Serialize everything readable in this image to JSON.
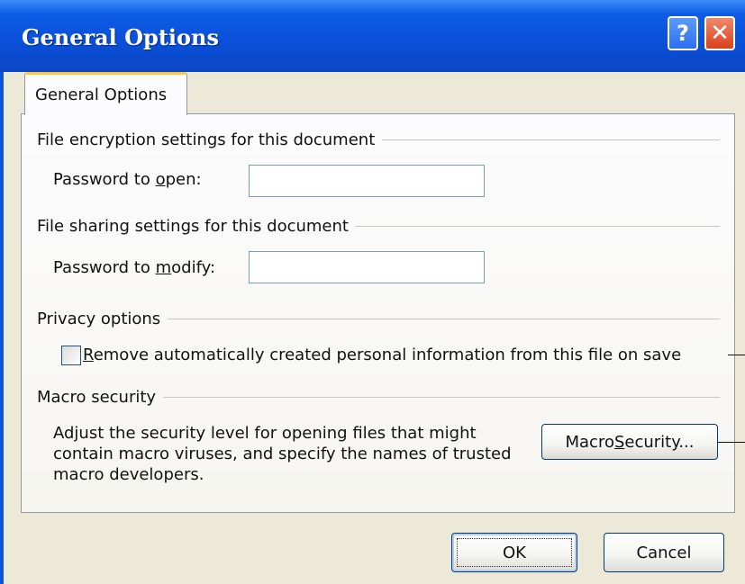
{
  "window": {
    "title": "General Options",
    "help_label": "?",
    "close_label": "✕"
  },
  "tab": {
    "label": "General Options"
  },
  "encryption": {
    "group_label": "File encryption settings for this document",
    "password_label_pre": "Password to ",
    "password_label_accel": "o",
    "password_label_post": "pen:",
    "password_value": ""
  },
  "sharing": {
    "group_label": "File sharing settings for this document",
    "password_label_pre": "Password to ",
    "password_label_accel": "m",
    "password_label_post": "odify:",
    "password_value": ""
  },
  "privacy": {
    "group_label": "Privacy options",
    "checkbox_accel": "R",
    "checkbox_label_rest": "emove automatically created personal information from this file on save",
    "checked": false
  },
  "macro": {
    "group_label": "Macro security",
    "description": "Adjust the security level for opening files that might contain macro viruses, and specify the names of trusted macro developers.",
    "button_pre": "Macro ",
    "button_accel": "S",
    "button_post": "ecurity..."
  },
  "footer": {
    "ok_label": "OK",
    "cancel_label": "Cancel"
  }
}
